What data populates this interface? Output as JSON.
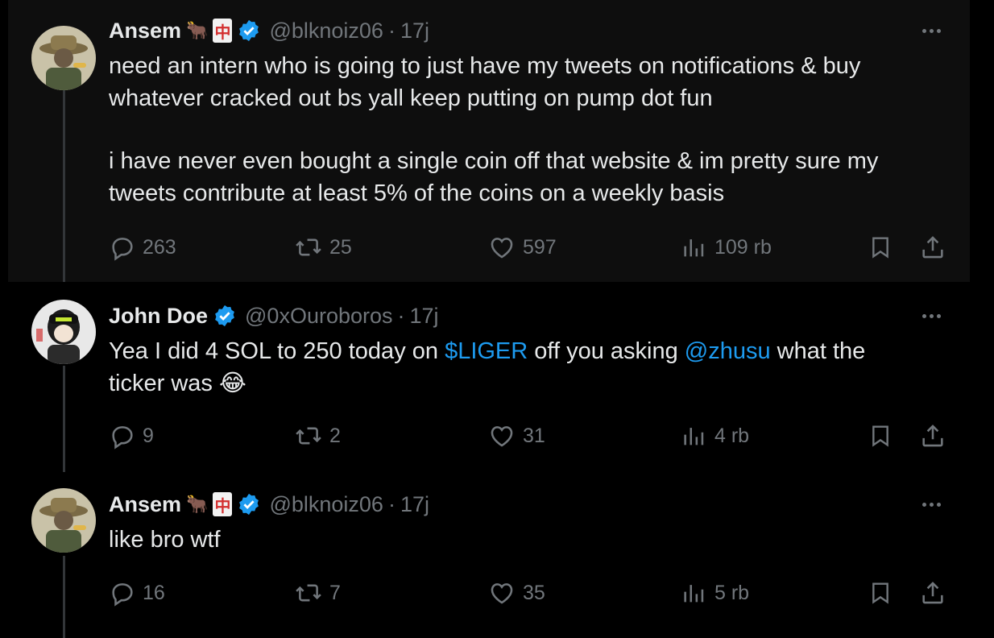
{
  "tweets": [
    {
      "name": "Ansem",
      "handle": "@blknoiz06",
      "dot": "·",
      "time": "17j",
      "lines": [
        "need an intern who is going to just have my tweets on notifications & buy",
        "whatever cracked out bs yall keep putting on pump dot fun",
        "i have never even bought a single coin off that website & im pretty sure my",
        "tweets contribute at least 5% of the coins on a weekly basis"
      ],
      "replies": "263",
      "reposts": "25",
      "likes": "597",
      "views": "109 rb"
    },
    {
      "name": "John Doe",
      "handle": "@0xOuroboros",
      "dot": "·",
      "time": "17j",
      "text_parts": {
        "a": "Yea I did 4 SOL to 250 today on ",
        "cashtag": "$LIGER",
        "b": " off you asking ",
        "mention": "@zhusu",
        "c": " what the",
        "d": "ticker was",
        "emoji": "😂"
      },
      "replies": "9",
      "reposts": "2",
      "likes": "31",
      "views": "4 rb"
    },
    {
      "name": "Ansem",
      "handle": "@blknoiz06",
      "dot": "·",
      "time": "17j",
      "lines": [
        "like bro wtf"
      ],
      "replies": "16",
      "reposts": "7",
      "likes": "35",
      "views": "5 rb"
    }
  ],
  "badge": {
    "emoji_ox": "🐂",
    "emoji_mahjong": "中"
  },
  "colors": {
    "background": "#000000",
    "highlight_background": "#0e0e0e",
    "text": "#e7e9ea",
    "muted": "#71767b",
    "accent": "#1d9bf0",
    "verified": "#1d9bf0",
    "thread_line": "#333639"
  },
  "icons": [
    "more-icon",
    "verified-icon",
    "reply-icon",
    "repost-icon",
    "like-icon",
    "views-icon",
    "bookmark-icon",
    "share-icon"
  ]
}
